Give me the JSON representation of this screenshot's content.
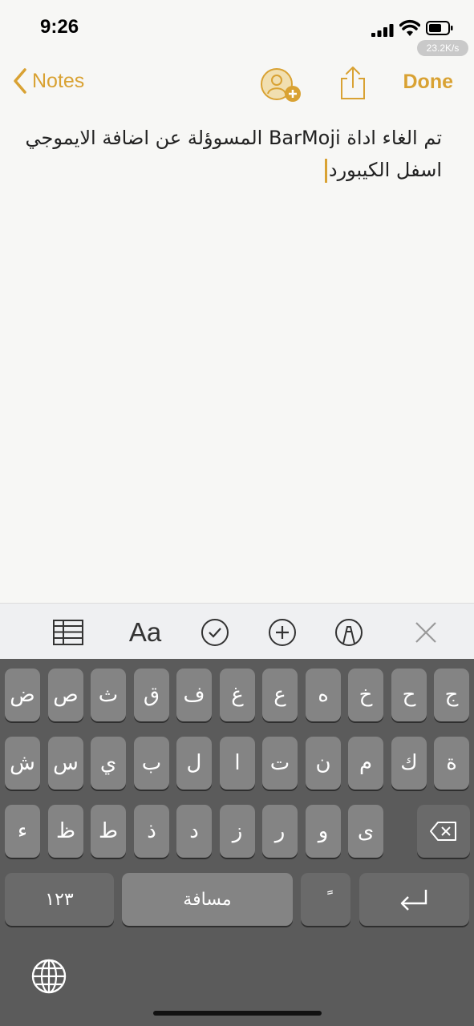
{
  "status": {
    "time": "9:26",
    "speed": "23.2K/s"
  },
  "nav": {
    "back_label": "Notes",
    "done_label": "Done"
  },
  "note": {
    "line1": "تم الغاء اداة BarMoji المسوؤلة عن اضافة الايموجي",
    "line2": "اسفل الكيبورد"
  },
  "toolbar": {
    "format_label": "Aa"
  },
  "keyboard": {
    "row1": [
      "ج",
      "ح",
      "خ",
      "ه",
      "ع",
      "غ",
      "ف",
      "ق",
      "ث",
      "ص",
      "ض"
    ],
    "row2": [
      "ة",
      "ك",
      "م",
      "ن",
      "ت",
      "ا",
      "ل",
      "ب",
      "ي",
      "س",
      "ش"
    ],
    "row3": [
      "ى",
      "و",
      "ر",
      "ز",
      "د",
      "ذ",
      "ط",
      "ظ",
      "ء"
    ],
    "numbers_label": "١٢٣",
    "space_label": "مسافة",
    "diacritic_label": "ًً"
  },
  "colors": {
    "accent": "#d9a233",
    "keyboard_bg": "#5b5b5b",
    "key_bg": "#848484"
  },
  "icons": {
    "signal": "signal-icon",
    "wifi": "wifi-icon",
    "battery": "battery-icon",
    "back": "chevron-left-icon",
    "contact": "add-person-icon",
    "share": "share-icon",
    "table": "table-icon",
    "checklist": "checklist-icon",
    "insert": "plus-circle-icon",
    "markup": "pen-circle-icon",
    "close": "close-icon",
    "backspace": "backspace-icon",
    "return": "return-icon",
    "globe": "globe-icon"
  }
}
